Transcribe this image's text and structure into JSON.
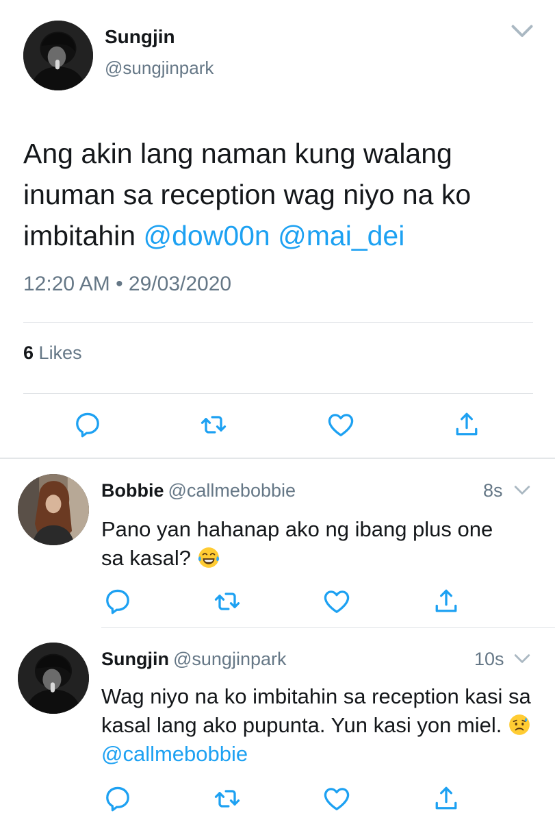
{
  "main_tweet": {
    "author_name": "Sungjin",
    "author_handle": "@sungjinpark",
    "text_plain": "Ang akin lang naman kung walang inuman sa reception wag niyo na ko imbitahin ",
    "mentions": [
      "@dow00n",
      "@mai_dei"
    ],
    "timestamp": "12:20 AM • 29/03/2020",
    "likes_count": "6",
    "likes_label": "Likes"
  },
  "replies": [
    {
      "author_name": "Bobbie",
      "author_handle": "@callmebobbie",
      "time_ago": "8s",
      "text": "Pano yan hahanap ako ng ibang plus one sa kasal?",
      "emoji": "face-with-tears-of-joy"
    },
    {
      "author_name": "Sungjin",
      "author_handle": "@sungjinpark",
      "time_ago": "10s",
      "text": "Wag niyo na ko imbitahin sa reception kasi sa kasal lang ako pupunta. Yun kasi yon miel.",
      "emoji": "sad-but-relieved-face",
      "mention": "@callmebobbie"
    }
  ],
  "colors": {
    "link": "#1da1f2",
    "secondary_text": "#657786",
    "primary_text": "#14171a",
    "action_icon": "#1da1f2"
  },
  "icons": [
    "chevron-down-icon",
    "reply-icon",
    "retweet-icon",
    "like-icon",
    "share-icon"
  ]
}
